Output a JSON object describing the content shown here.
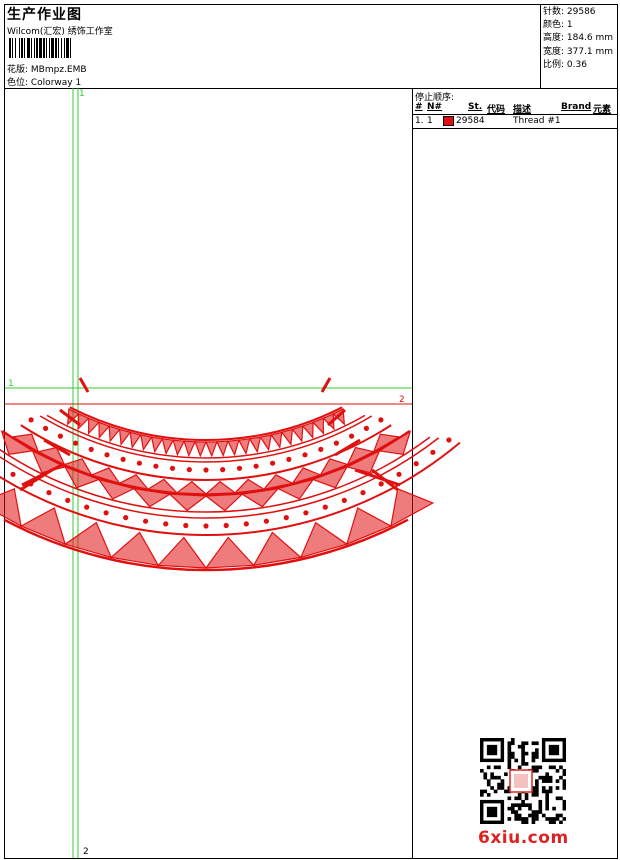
{
  "header": {
    "title": "生产作业图",
    "subtitle": "Wilcom(汇宏) 绣饰工作室",
    "design_label": "花版: MBmpz.EMB",
    "colorway_label": "色位: Colorway 1"
  },
  "stats": {
    "stitches": "针数: 29586",
    "colors": "颜色: 1",
    "height": "高度: 184.6 mm",
    "width": "宽度: 377.1 mm",
    "scale": "比例: 0.36"
  },
  "stop_sequence": {
    "title": "停止顺序:",
    "columns": [
      "#",
      "N#",
      "St.",
      "代码",
      "描述",
      "Brand",
      "元素"
    ],
    "rows": [
      {
        "index": "1.",
        "needle": "1",
        "stitches": "29584",
        "desc": "Thread #1",
        "color": "#e01010"
      }
    ]
  },
  "guides": {
    "v1": "1",
    "v2": "2",
    "h1": "1",
    "h2": "2"
  },
  "colors": {
    "thread": "#e01010",
    "guide_green": "#33cc33",
    "guide_red": "#e01010"
  },
  "watermark": {
    "brand": "6xiu.com"
  }
}
